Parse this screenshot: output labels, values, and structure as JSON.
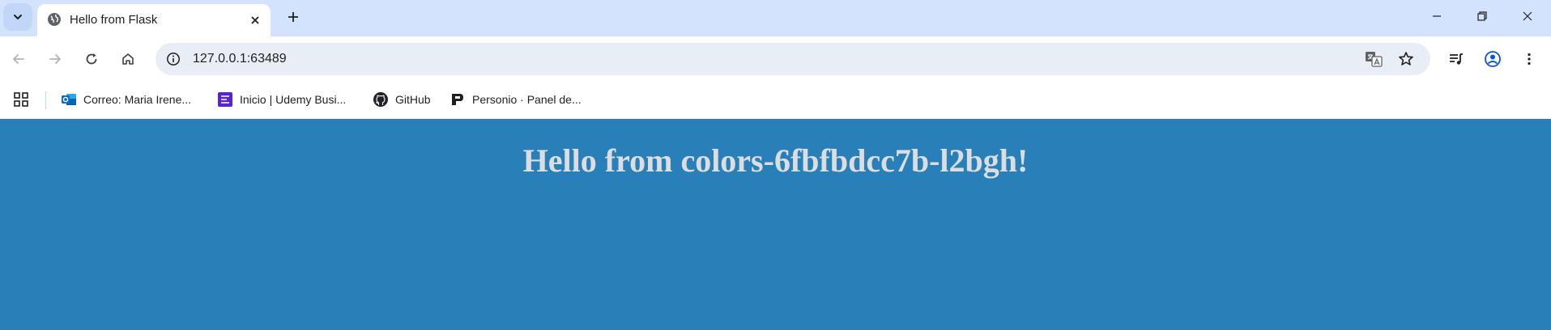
{
  "browser": {
    "tab": {
      "title": "Hello from Flask"
    },
    "address_bar": {
      "url": "127.0.0.1:63489"
    },
    "bookmarks": [
      {
        "label": "Correo: Maria Irene..."
      },
      {
        "label": "Inicio | Udemy Busi..."
      },
      {
        "label": "GitHub"
      },
      {
        "label": "Personio · Panel de..."
      }
    ]
  },
  "page": {
    "heading": "Hello from colors-6fbfbdcc7b-l2bgh!",
    "background_color": "#2980b9",
    "heading_color": "#dcdde1"
  }
}
